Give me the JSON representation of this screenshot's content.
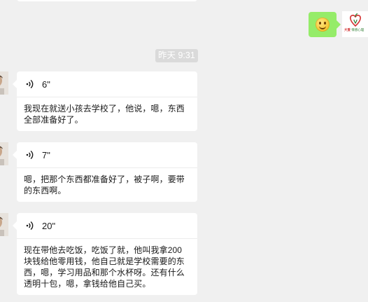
{
  "outgoing": {
    "emoji_icon": "smiley-face-icon",
    "avatar": {
      "icon": "apple-heart-logo-icon",
      "brand_main": "大爱",
      "brand_sub": "情感心理"
    }
  },
  "timestamp": "昨天 9:31",
  "messages": [
    {
      "duration": "6\"",
      "transcript": "我现在就送小孩去学校了，他说，嗯，东西全部准备好了。"
    },
    {
      "duration": "7\"",
      "transcript": "嗯，把那个东西都准备好了，被子啊，要带的东西啊。"
    },
    {
      "duration": "20\"",
      "transcript": "现在带他去吃饭，吃饭了就，他叫我拿200块钱给他零用钱，他自己就是学校需要的东西，嗯，学习用品和那个水杯呀。还有什么透明十包，嗯，拿钱给他自己买。"
    }
  ],
  "colors": {
    "background": "#f0f0f0",
    "outgoing_bubble": "#95ec69",
    "incoming_bubble": "#ffffff",
    "timestamp_bg": "#dadada"
  }
}
